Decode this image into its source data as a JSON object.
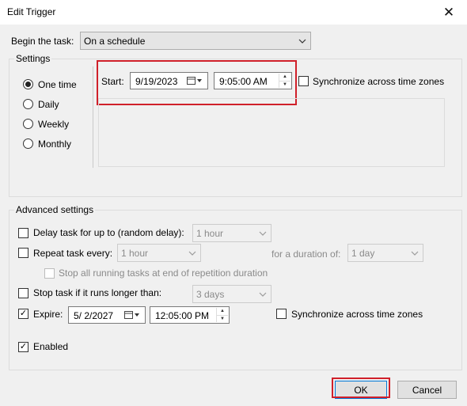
{
  "window": {
    "title": "Edit Trigger",
    "close_glyph": "✕"
  },
  "begin": {
    "label": "Begin the task:",
    "selected": "On a schedule"
  },
  "settings": {
    "group_title": "Settings",
    "options": [
      {
        "label": "One time",
        "selected": true
      },
      {
        "label": "Daily",
        "selected": false
      },
      {
        "label": "Weekly",
        "selected": false
      },
      {
        "label": "Monthly",
        "selected": false
      }
    ],
    "start_label": "Start:",
    "start_date": "9/19/2023",
    "start_time": "9:05:00 AM",
    "sync_label": "Synchronize across time zones",
    "sync_checked": false
  },
  "advanced": {
    "group_title": "Advanced settings",
    "delay": {
      "label": "Delay task for up to (random delay):",
      "checked": false,
      "value": "1 hour"
    },
    "repeat": {
      "label": "Repeat task every:",
      "checked": false,
      "value": "1 hour",
      "duration_label": "for a duration of:",
      "duration_value": "1 day"
    },
    "stop_all": {
      "label": "Stop all running tasks at end of repetition duration",
      "checked": false
    },
    "stop_longer": {
      "label": "Stop task if it runs longer than:",
      "checked": false,
      "value": "3 days"
    },
    "expire": {
      "label": "Expire:",
      "checked": true,
      "date": "5/ 2/2027",
      "time": "12:05:00 PM",
      "sync_label": "Synchronize across time zones",
      "sync_checked": false
    },
    "enabled": {
      "label": "Enabled",
      "checked": true
    }
  },
  "buttons": {
    "ok": "OK",
    "cancel": "Cancel"
  },
  "icons": {
    "dropdown": "chevron-down-icon",
    "calendar": "calendar-icon",
    "spin": "spinner-icon",
    "check": "✓"
  },
  "colors": {
    "highlight": "#d0202a",
    "accent": "#0078d7"
  }
}
